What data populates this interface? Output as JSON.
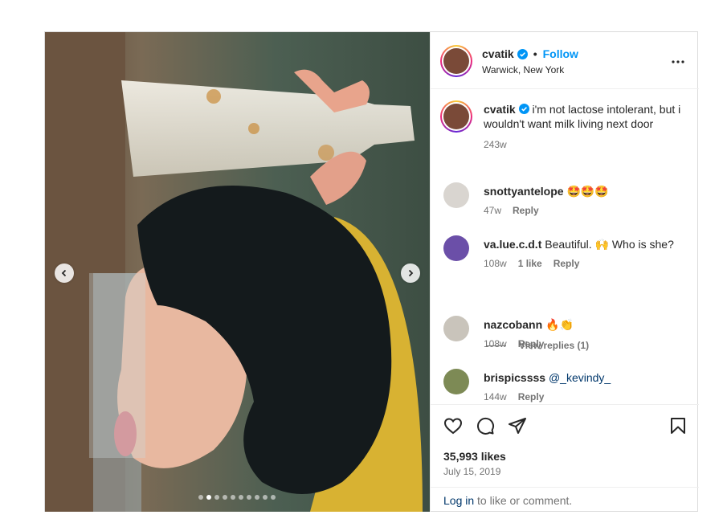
{
  "post": {
    "username": "cvatik",
    "follow_label": "Follow",
    "separator": "•",
    "location": "Warwick, New York",
    "caption_text": "i'm not lactose intolerant, but i wouldn't want milk living next door",
    "caption_age": "243w",
    "carousel": {
      "dot_count": 10,
      "active_index": 1
    }
  },
  "comments": [
    {
      "username": "snottyantelope",
      "text": "🤩🤩🤩",
      "age": "47w",
      "likes": "",
      "reply_label": "Reply"
    },
    {
      "username": "va.lue.c.d.t",
      "text": "Beautiful. 🙌 Who is she?",
      "age": "108w",
      "likes": "1 like",
      "reply_label": "Reply"
    },
    {
      "username": "nazcobann",
      "text": "🔥👏",
      "age": "108w",
      "likes": "",
      "reply_label": "Reply"
    },
    {
      "username": "brispicssss",
      "text": "@_kevindy_",
      "age": "144w",
      "likes": "",
      "reply_label": "Reply"
    }
  ],
  "view_replies_label": "View replies (1)",
  "engagement": {
    "likes": "35,993 likes",
    "date": "July 15, 2019"
  },
  "footer": {
    "login_label": "Log in",
    "rest_label": "to like or comment."
  },
  "colors": {
    "accent": "#0095f6",
    "verified": "#0095f6",
    "border": "#dbdbdb",
    "muted": "#737373"
  },
  "icons": [
    "chevron-left-icon",
    "chevron-right-icon",
    "more-icon",
    "heart-icon",
    "comment-icon",
    "share-icon",
    "bookmark-icon",
    "verified-badge-icon"
  ]
}
